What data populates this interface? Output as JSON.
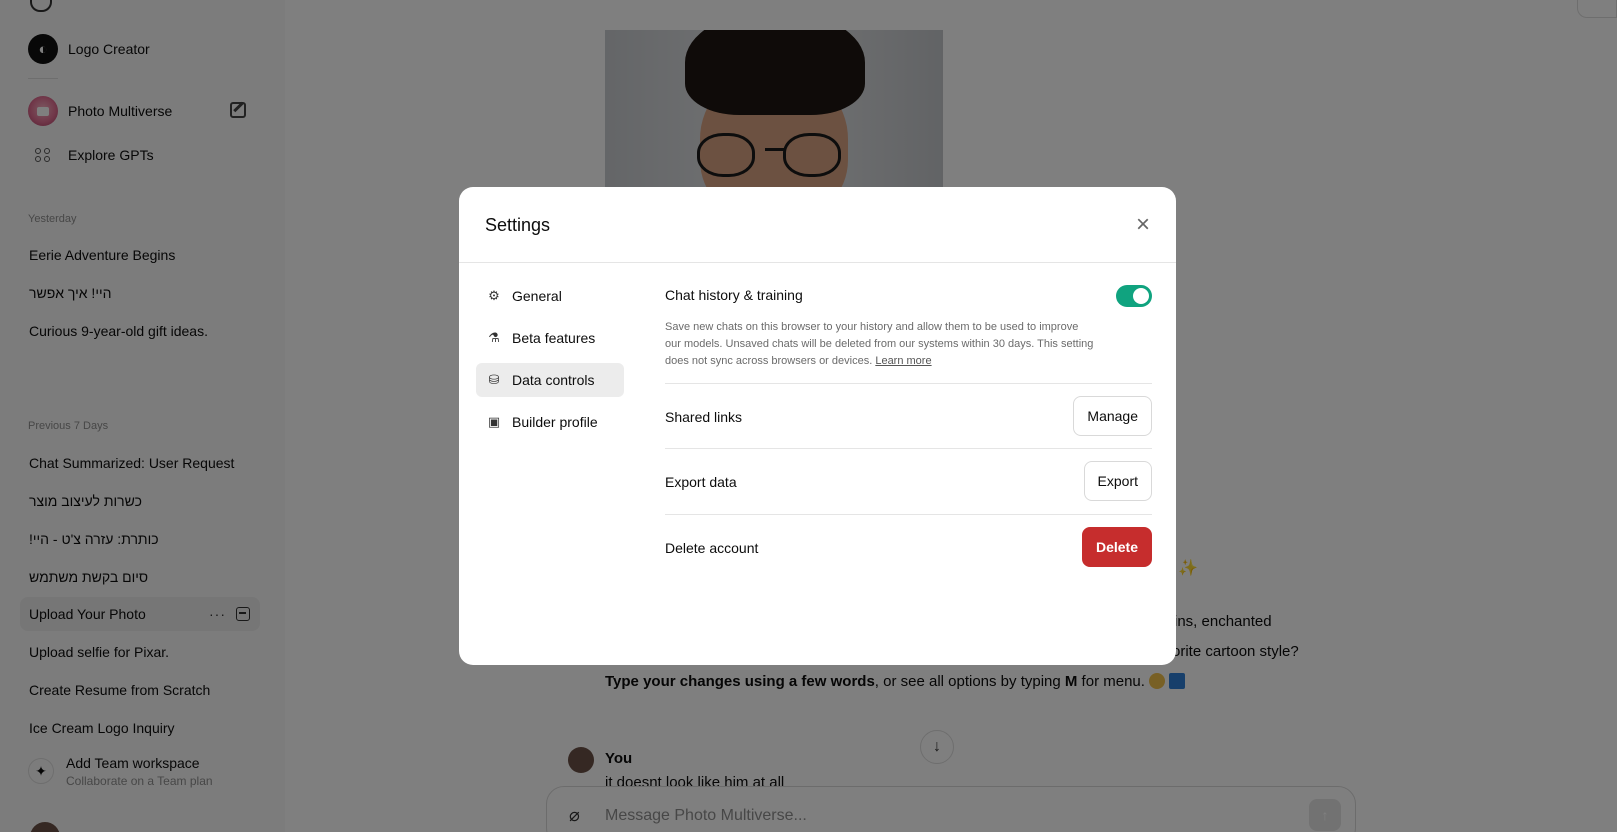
{
  "sidebar": {
    "gpts": [
      {
        "label": "Logo Creator",
        "icon": "logo-creator-icon"
      },
      {
        "label": "Photo Multiverse",
        "icon": "photo-multiverse-icon"
      },
      {
        "label": "Explore GPTs",
        "icon": "grid-icon"
      }
    ],
    "sections": {
      "yesterday": "Yesterday",
      "previous7": "Previous 7 Days"
    },
    "yesterday_items": [
      "Eerie Adventure Begins",
      "היי! איך אפשר",
      "Curious 9-year-old gift ideas."
    ],
    "previous7_items": [
      "Chat Summarized: User Request",
      "כשרות לעיצוב מוצר",
      "כותרת: עזרה צ'ט - היי!",
      "סיום בקשת משתמש",
      "Upload Your Photo",
      "Upload selfie for Pixar.",
      "Create Resume from Scratch",
      "Ice Cream Logo Inquiry"
    ],
    "row_more": "···",
    "team": {
      "title": "Add Team workspace",
      "subtitle": "Collaborate on a Team plan"
    }
  },
  "chat": {
    "partial_line1": "ins, enchanted",
    "partial_line2": "orite cartoon style?",
    "bold_part": "Type your changes using a few words",
    "mid_part": ", or see all options by typing ",
    "menu_key": "M",
    "end_part": " for menu.",
    "sparkle": "✨",
    "you_name": "You",
    "you_text": "it doesnt look like him at all",
    "composer_placeholder": "Message Photo Multiverse...",
    "scroll_arrow": "↓",
    "send_arrow": "↑"
  },
  "settings": {
    "title": "Settings",
    "close": "×",
    "nav": [
      {
        "label": "General",
        "icon": "gear-icon",
        "glyph": "⚙"
      },
      {
        "label": "Beta features",
        "icon": "flask-icon",
        "glyph": "⚗"
      },
      {
        "label": "Data controls",
        "icon": "database-icon",
        "glyph": "⛁"
      },
      {
        "label": "Builder profile",
        "icon": "id-card-icon",
        "glyph": "▣"
      }
    ],
    "active_nav": "Data controls",
    "chat_history": {
      "label": "Chat history & training",
      "enabled": true,
      "description": "Save new chats on this browser to your history and allow them to be used to improve our models. Unsaved chats will be deleted from our systems within 30 days. This setting does not sync across browsers or devices.",
      "learn_more": "Learn more"
    },
    "shared_links": {
      "label": "Shared links",
      "button": "Manage"
    },
    "export_data": {
      "label": "Export data",
      "button": "Export"
    },
    "delete_account": {
      "label": "Delete account",
      "button": "Delete"
    }
  },
  "colors": {
    "toggle_on": "#10a37f",
    "danger": "#c62d2d",
    "overlay": "rgba(0,0,0,0.5)"
  }
}
